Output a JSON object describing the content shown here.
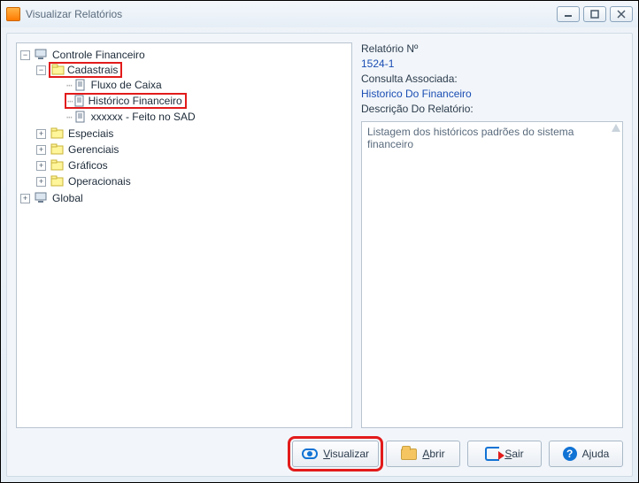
{
  "window": {
    "title": "Visualizar Relatórios"
  },
  "tree": {
    "root": {
      "label": "Controle Financeiro",
      "children": {
        "cadastrais": {
          "label": "Cadastrais",
          "children": {
            "fluxo": {
              "label": "Fluxo de Caixa"
            },
            "historico": {
              "label": "Histórico Financeiro"
            },
            "xxxxxx": {
              "label": "xxxxxx - Feito no SAD"
            }
          }
        },
        "especiais": {
          "label": "Especiais"
        },
        "gerenciais": {
          "label": "Gerenciais"
        },
        "graficos": {
          "label": "Gráficos"
        },
        "operacionais": {
          "label": "Operacionais"
        }
      }
    },
    "global": {
      "label": "Global"
    }
  },
  "details": {
    "relatorio_no_label": "Relatório Nº",
    "relatorio_no_value": "1524-1",
    "consulta_label": "Consulta Associada:",
    "consulta_value": "Historico Do Financeiro",
    "descricao_label": "Descrição Do Relatório:",
    "descricao_text": "Listagem dos históricos padrões do sistema financeiro"
  },
  "buttons": {
    "visualizar": "isualizar",
    "visualizar_u": "V",
    "abrir": "brir",
    "abrir_u": "A",
    "sair": "air",
    "sair_u": "S",
    "ajuda": "Ajuda"
  }
}
